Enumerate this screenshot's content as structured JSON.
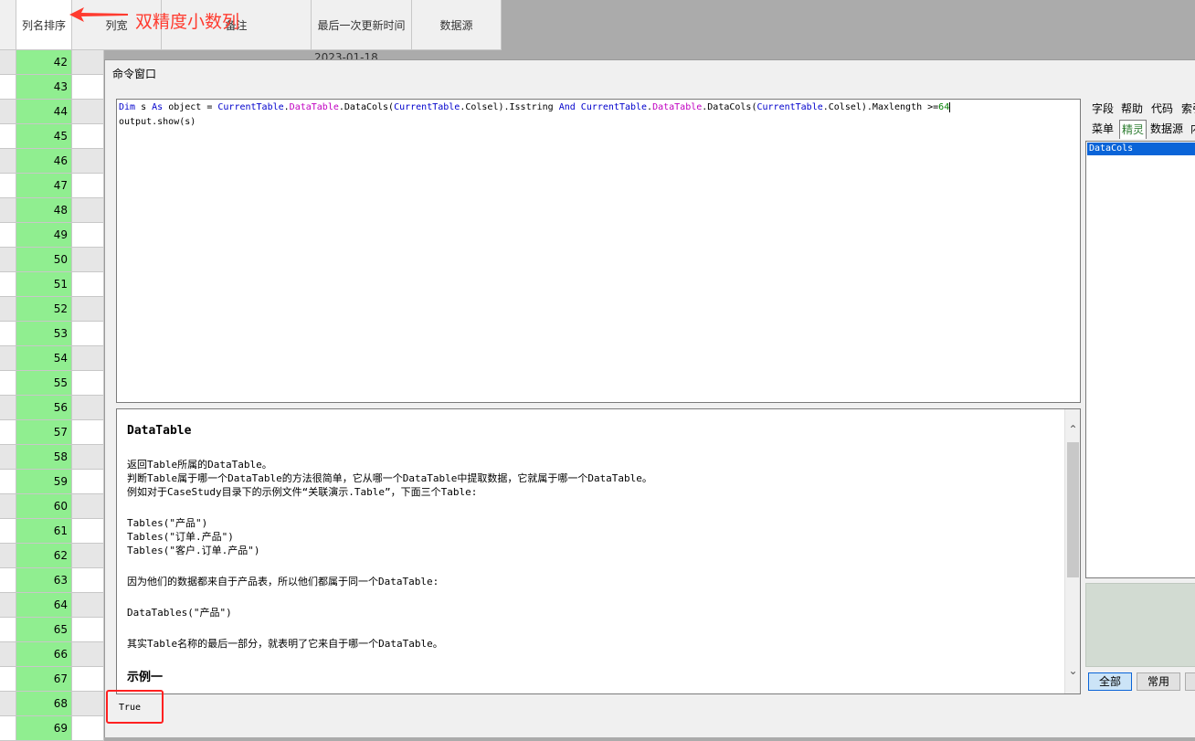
{
  "grid": {
    "headers": [
      "列名排序",
      "列宽",
      "备注",
      "最后一次更新时间",
      "数据源"
    ],
    "seq_values": [
      "42",
      "43",
      "44",
      "45",
      "46",
      "47",
      "48",
      "49",
      "50",
      "51",
      "52",
      "53",
      "54",
      "55",
      "56",
      "57",
      "58",
      "59",
      "60",
      "61",
      "62",
      "63",
      "64",
      "65",
      "66",
      "67",
      "68",
      "69"
    ],
    "peek_text": "2023-01-18"
  },
  "annotation": {
    "text": "双精度小数列",
    "color": "#ff3b2f"
  },
  "window": {
    "title": "命令窗口",
    "code": {
      "line1": {
        "p1": "Dim",
        "p2": " s ",
        "p3": "As",
        "p4": " object = ",
        "p5": "CurrentTable",
        "p6": ".",
        "p7": "DataTable",
        "p8": ".DataCols(",
        "p9": "CurrentTable",
        "p10": ".Colsel).Isstring ",
        "p11": "And",
        "p12": " ",
        "p13": "CurrentTable",
        "p14": ".",
        "p15": "DataTable",
        "p16": ".DataCols(",
        "p17": "CurrentTable",
        "p18": ".Colsel).Maxlength >=",
        "p19": "64"
      },
      "line2": "output.show(s)"
    },
    "help": {
      "title": "DataTable",
      "l1": "返回Table所属的DataTable。",
      "l2": "判断Table属于哪一个DataTable的方法很简单，它从哪一个DataTable中提取数据，它就属于哪一个DataTable。",
      "l3": "例如对于CaseStudy目录下的示例文件“关联演示.Table”，下面三个Table:",
      "l4": "Tables(\"产品\")",
      "l5": "Tables(\"订单.产品\")",
      "l6": "Tables(\"客户.订单.产品\")",
      "l7": "因为他们的数据都来自于产品表，所以他们都属于同一个DataTable:",
      "l8": "DataTables(\"产品\")",
      "l9": "其实Table名称的最后一部分，就表明了它来自于哪一个DataTable。",
      "l10": "示例一"
    },
    "output": "True",
    "right_tabs_row1": [
      "字段",
      "帮助",
      "代码",
      "索引"
    ],
    "right_tabs_row2": [
      "菜单",
      "精灵",
      "数据源",
      "内"
    ],
    "list_selected": "DataCols",
    "buttons": [
      "全部",
      "常用"
    ]
  },
  "colors": {
    "seq_green": "#90ee90",
    "highlight_red": "#ff3b2f",
    "select_blue": "#0a64d8"
  }
}
